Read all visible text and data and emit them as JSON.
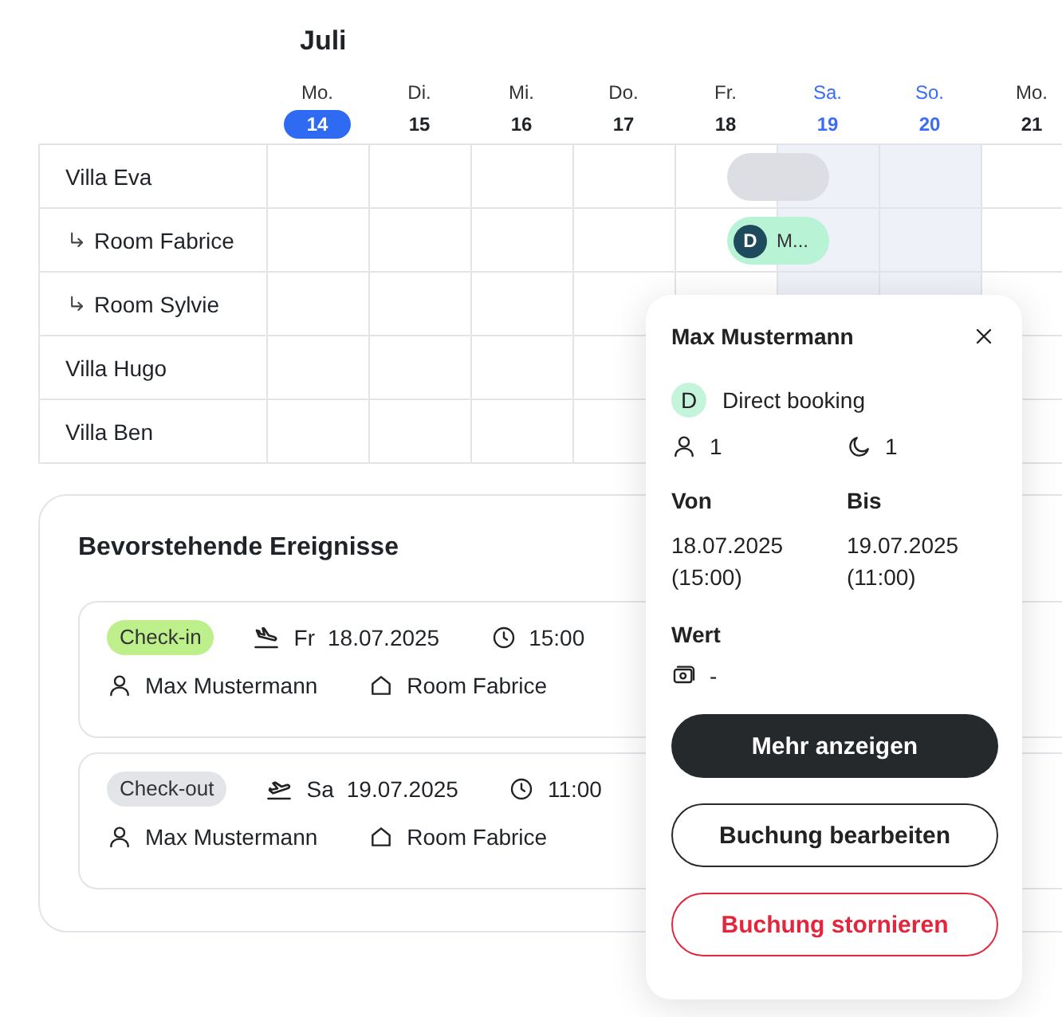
{
  "calendar": {
    "month": "Juli",
    "days": [
      {
        "weekday": "Mo.",
        "date": "14",
        "today": true,
        "weekend": false
      },
      {
        "weekday": "Di.",
        "date": "15",
        "today": false,
        "weekend": false
      },
      {
        "weekday": "Mi.",
        "date": "16",
        "today": false,
        "weekend": false
      },
      {
        "weekday": "Do.",
        "date": "17",
        "today": false,
        "weekend": false
      },
      {
        "weekday": "Fr.",
        "date": "18",
        "today": false,
        "weekend": false
      },
      {
        "weekday": "Sa.",
        "date": "19",
        "today": false,
        "weekend": true
      },
      {
        "weekday": "So.",
        "date": "20",
        "today": false,
        "weekend": true
      },
      {
        "weekday": "Mo.",
        "date": "21",
        "today": false,
        "weekend": false
      }
    ],
    "units": [
      {
        "name": "Villa Eva",
        "cells": [
          {
            "kind": "empty"
          },
          {
            "kind": "empty"
          },
          {
            "kind": "empty"
          },
          {
            "kind": "empty"
          },
          {
            "kind": "blocked"
          },
          {
            "kind": "empty"
          },
          {
            "kind": "empty"
          },
          {
            "kind": "empty"
          }
        ],
        "children": [
          {
            "name": "Room Fabrice",
            "cells": [
              {
                "kind": "empty"
              },
              {
                "kind": "empty"
              },
              {
                "kind": "empty"
              },
              {
                "kind": "empty"
              },
              {
                "kind": "booking",
                "avatar": "D",
                "label": "M..."
              },
              {
                "kind": "empty"
              },
              {
                "kind": "empty"
              },
              {
                "kind": "empty"
              }
            ]
          },
          {
            "name": "Room Sylvie",
            "cells": [
              {
                "kind": "empty"
              },
              {
                "kind": "empty"
              },
              {
                "kind": "empty"
              },
              {
                "kind": "empty"
              },
              {
                "kind": "empty"
              },
              {
                "kind": "empty"
              },
              {
                "kind": "empty"
              },
              {
                "kind": "empty"
              }
            ]
          }
        ]
      },
      {
        "name": "Villa Hugo",
        "cells": [
          {
            "kind": "empty"
          },
          {
            "kind": "empty"
          },
          {
            "kind": "empty"
          },
          {
            "kind": "empty"
          },
          {
            "kind": "empty"
          },
          {
            "kind": "empty"
          },
          {
            "kind": "empty"
          },
          {
            "kind": "empty"
          }
        ]
      },
      {
        "name": "Villa Ben",
        "cells": [
          {
            "kind": "empty"
          },
          {
            "kind": "empty"
          },
          {
            "kind": "empty"
          },
          {
            "kind": "empty"
          },
          {
            "kind": "empty"
          },
          {
            "kind": "empty"
          },
          {
            "kind": "empty"
          },
          {
            "kind": "empty"
          }
        ]
      }
    ]
  },
  "upcoming_events": {
    "title": "Bevorstehende Ereignisse",
    "events": [
      {
        "kind": "check-in",
        "badge": "Check-in",
        "weekday": "Fr",
        "date": "18.07.2025",
        "time": "15:00",
        "guest": "Max Mustermann",
        "unit": "Room Fabrice"
      },
      {
        "kind": "check-out",
        "badge": "Check-out",
        "weekday": "Sa",
        "date": "19.07.2025",
        "time": "11:00",
        "guest": "Max Mustermann",
        "unit": "Room Fabrice"
      }
    ]
  },
  "booking_popup": {
    "title": "Max Mustermann",
    "source_avatar": "D",
    "source": "Direct booking",
    "guests": "1",
    "nights": "1",
    "from_label": "Von",
    "from_date": "18.07.2025",
    "from_time": "(15:00)",
    "to_label": "Bis",
    "to_date": "19.07.2025",
    "to_time": "(11:00)",
    "value_label": "Wert",
    "value": "-",
    "buttons": [
      {
        "kind": "primary",
        "label": "Mehr anzeigen"
      },
      {
        "kind": "secondary",
        "label": "Buchung bearbeiten"
      },
      {
        "kind": "danger",
        "label": "Buchung stornieren"
      }
    ]
  }
}
